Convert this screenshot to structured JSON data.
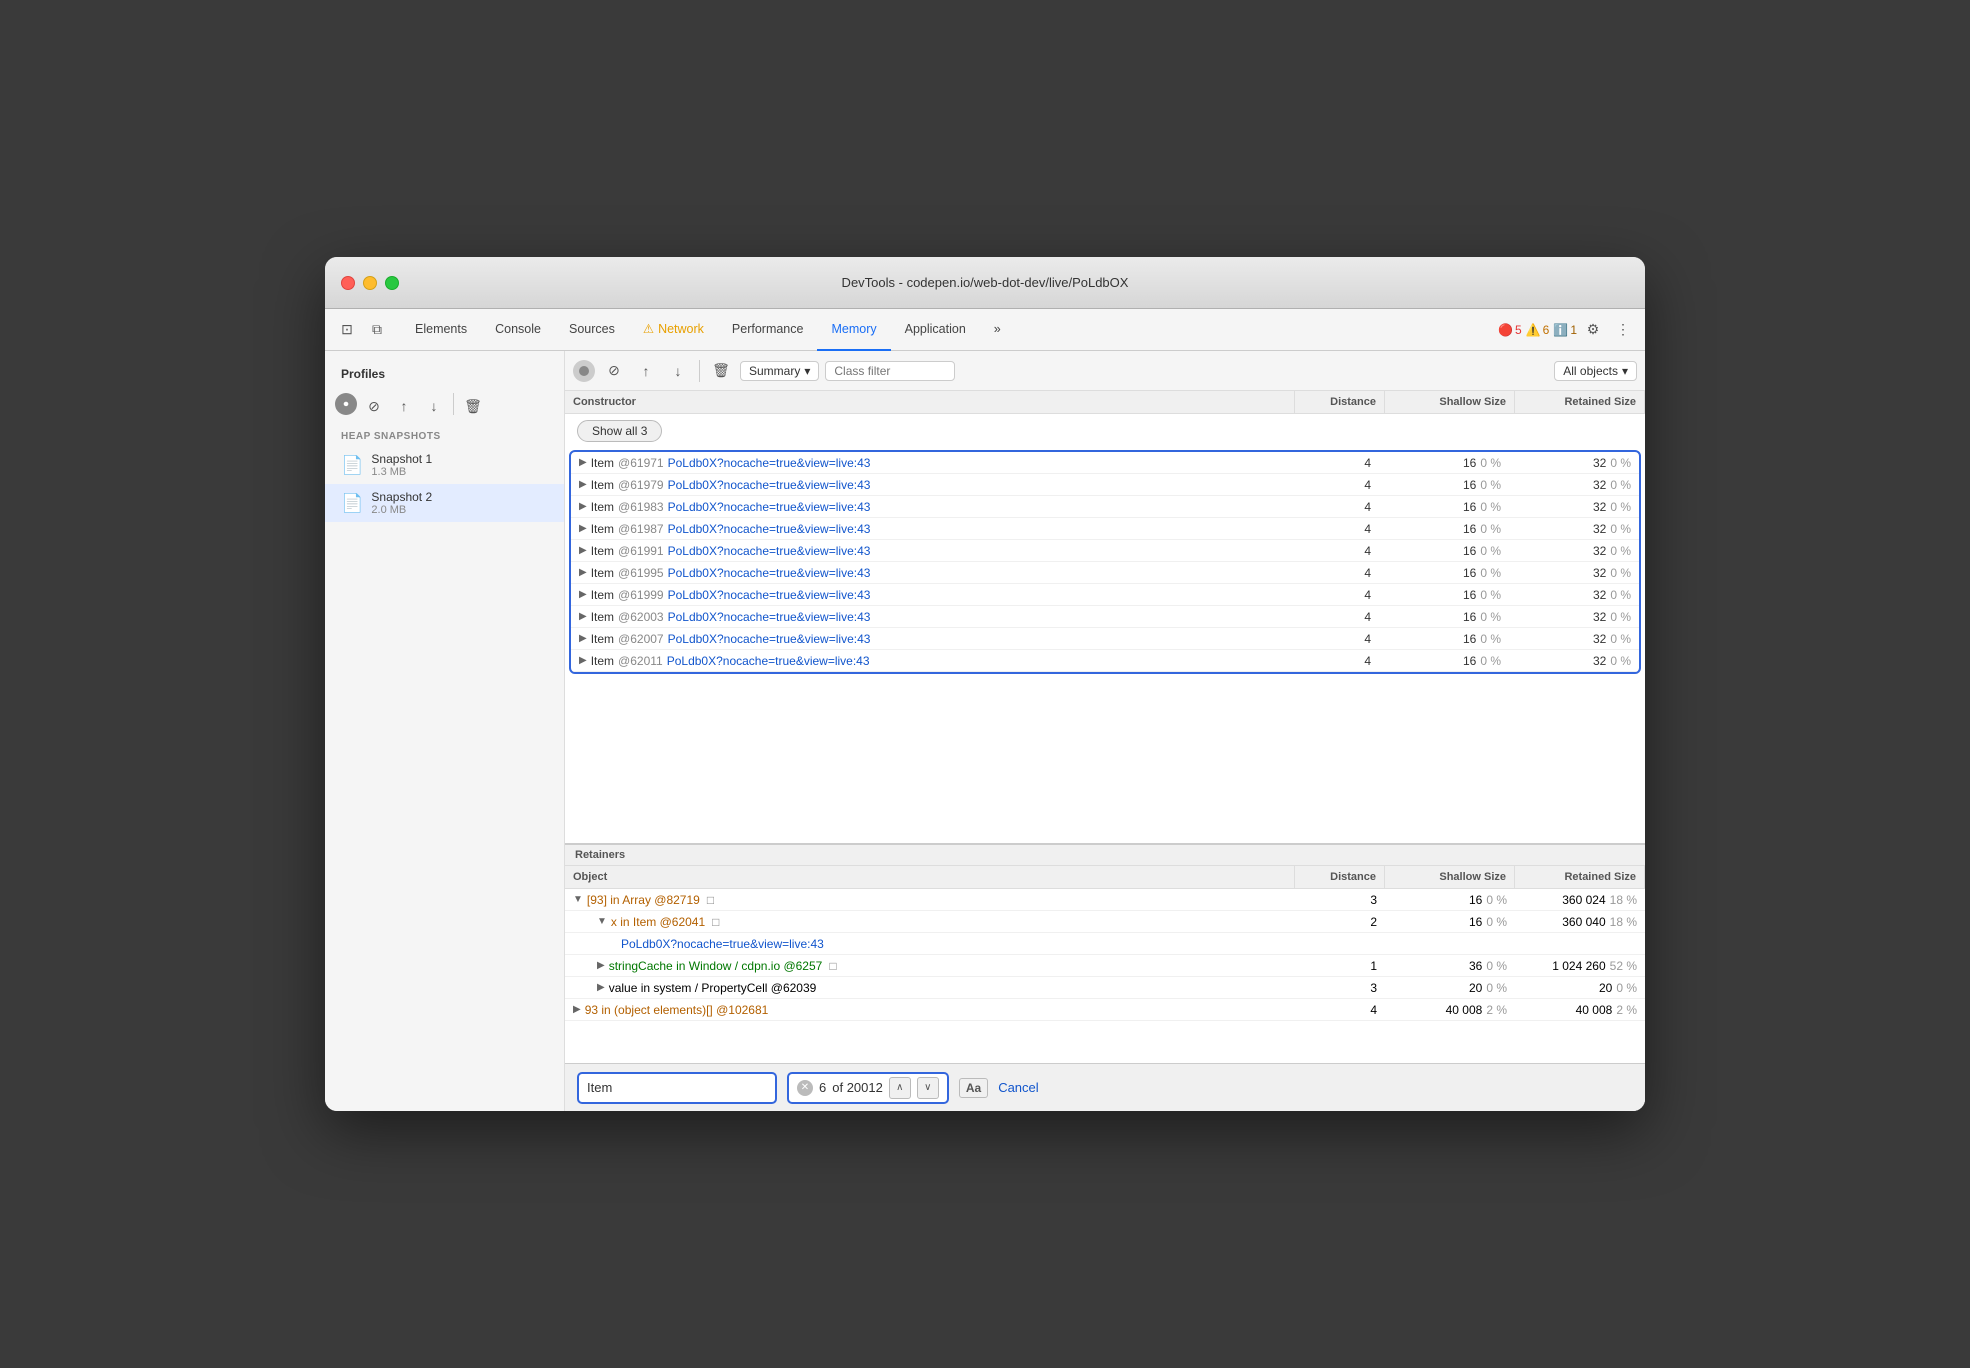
{
  "window": {
    "title": "DevTools - codepen.io/web-dot-dev/live/PoLdbOX"
  },
  "tabs": [
    {
      "id": "elements",
      "label": "Elements",
      "active": false
    },
    {
      "id": "console",
      "label": "Console",
      "active": false
    },
    {
      "id": "sources",
      "label": "Sources",
      "active": false
    },
    {
      "id": "network",
      "label": "Network",
      "active": false,
      "warning": true
    },
    {
      "id": "performance",
      "label": "Performance",
      "active": false
    },
    {
      "id": "memory",
      "label": "Memory",
      "active": true
    },
    {
      "id": "application",
      "label": "Application",
      "active": false
    }
  ],
  "badges": {
    "error_count": "5",
    "warn_count": "6",
    "info_count": "1"
  },
  "controls": {
    "summary_label": "Summary",
    "class_filter_placeholder": "Class filter",
    "all_objects_label": "All objects"
  },
  "sidebar": {
    "profiles_title": "Profiles",
    "snapshots_title": "HEAP SNAPSHOTS",
    "snapshots": [
      {
        "name": "Snapshot 1",
        "size": "1.3 MB"
      },
      {
        "name": "Snapshot 2",
        "size": "2.0 MB"
      }
    ]
  },
  "table": {
    "headers": [
      "Constructor",
      "Distance",
      "Shallow Size",
      "Retained Size"
    ],
    "show_all_btn": "Show all 3",
    "rows": [
      {
        "name": "Item",
        "id": "@61971",
        "link": "PoLdb0X?nocache=true&view=live:43",
        "distance": "4",
        "shallow_val": "16",
        "shallow_pct": "0 %",
        "retained_val": "32",
        "retained_pct": "0 %"
      },
      {
        "name": "Item",
        "id": "@61979",
        "link": "PoLdb0X?nocache=true&view=live:43",
        "distance": "4",
        "shallow_val": "16",
        "shallow_pct": "0 %",
        "retained_val": "32",
        "retained_pct": "0 %"
      },
      {
        "name": "Item",
        "id": "@61983",
        "link": "PoLdb0X?nocache=true&view=live:43",
        "distance": "4",
        "shallow_val": "16",
        "shallow_pct": "0 %",
        "retained_val": "32",
        "retained_pct": "0 %"
      },
      {
        "name": "Item",
        "id": "@61987",
        "link": "PoLdb0X?nocache=true&view=live:43",
        "distance": "4",
        "shallow_val": "16",
        "shallow_pct": "0 %",
        "retained_val": "32",
        "retained_pct": "0 %"
      },
      {
        "name": "Item",
        "id": "@61991",
        "link": "PoLdb0X?nocache=true&view=live:43",
        "distance": "4",
        "shallow_val": "16",
        "shallow_pct": "0 %",
        "retained_val": "32",
        "retained_pct": "0 %"
      },
      {
        "name": "Item",
        "id": "@61995",
        "link": "PoLdb0X?nocache=true&view=live:43",
        "distance": "4",
        "shallow_val": "16",
        "shallow_pct": "0 %",
        "retained_val": "32",
        "retained_pct": "0 %"
      },
      {
        "name": "Item",
        "id": "@61999",
        "link": "PoLdb0X?nocache=true&view=live:43",
        "distance": "4",
        "shallow_val": "16",
        "shallow_pct": "0 %",
        "retained_val": "32",
        "retained_pct": "0 %"
      },
      {
        "name": "Item",
        "id": "@62003",
        "link": "PoLdb0X?nocache=true&view=live:43",
        "distance": "4",
        "shallow_val": "16",
        "shallow_pct": "0 %",
        "retained_val": "32",
        "retained_pct": "0 %"
      },
      {
        "name": "Item",
        "id": "@62007",
        "link": "PoLdb0X?nocache=true&view=live:43",
        "distance": "4",
        "shallow_val": "16",
        "shallow_pct": "0 %",
        "retained_val": "32",
        "retained_pct": "0 %"
      },
      {
        "name": "Item",
        "id": "@62011",
        "link": "PoLdb0X?nocache=true&view=live:43",
        "distance": "4",
        "shallow_val": "16",
        "shallow_pct": "0 %",
        "retained_val": "32",
        "retained_pct": "0 %"
      }
    ]
  },
  "retainers": {
    "title": "Retainers",
    "headers": [
      "Object",
      "Distance",
      "Shallow Size",
      "Retained Size"
    ],
    "rows": [
      {
        "indent": 0,
        "arrow": "▼",
        "text": "[93] in Array @82719",
        "extra": "□",
        "distance": "3",
        "shallow_val": "16",
        "shallow_pct": "0 %",
        "retained_val": "360 024",
        "retained_pct": "18 %",
        "color": "orange"
      },
      {
        "indent": 1,
        "arrow": "▼",
        "text": "x in Item @62041",
        "extra": "□",
        "distance": "2",
        "shallow_val": "16",
        "shallow_pct": "0 %",
        "retained_val": "360 040",
        "retained_pct": "18 %",
        "color": "orange"
      },
      {
        "indent": 2,
        "arrow": "",
        "text": "PoLdb0X?nocache=true&view=live:43",
        "extra": "",
        "distance": "",
        "shallow_val": "",
        "shallow_pct": "",
        "retained_val": "",
        "retained_pct": "",
        "color": "blue",
        "is_link": true
      },
      {
        "indent": 1,
        "arrow": "▶",
        "text": "stringCache in Window / cdpn.io @6257",
        "extra": "□",
        "distance": "1",
        "shallow_val": "36",
        "shallow_pct": "0 %",
        "retained_val": "1 024 260",
        "retained_pct": "52 %",
        "color": "green"
      },
      {
        "indent": 1,
        "arrow": "▶",
        "text": "value in system / PropertyCell @62039",
        "extra": "",
        "distance": "3",
        "shallow_val": "20",
        "shallow_pct": "0 %",
        "retained_val": "20",
        "retained_pct": "0 %",
        "color": "normal"
      },
      {
        "indent": 0,
        "arrow": "▶",
        "text": "93 in (object elements)[] @102681",
        "extra": "",
        "distance": "4",
        "shallow_val": "40 008",
        "shallow_pct": "2 %",
        "retained_val": "40 008",
        "retained_pct": "2 %",
        "color": "orange"
      }
    ]
  },
  "search": {
    "input_value": "Item",
    "result_current": "6",
    "result_total": "of 20012",
    "match_case_label": "Aa",
    "cancel_label": "Cancel"
  }
}
